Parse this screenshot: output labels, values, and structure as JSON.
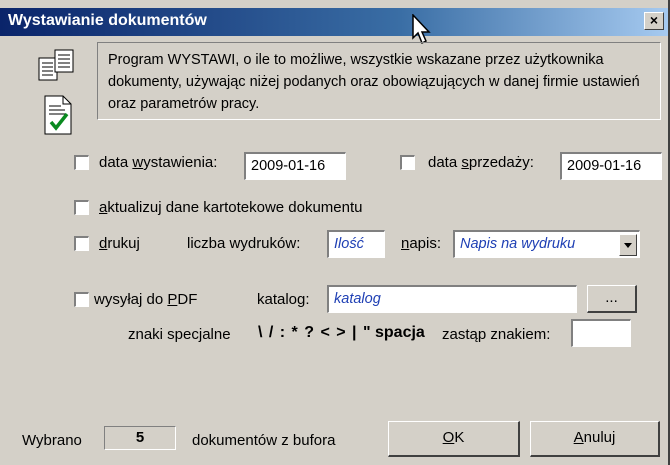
{
  "window": {
    "title": "Wystawianie dokumentów",
    "close_glyph": "×"
  },
  "info_text": "Program WYSTAWI, o ile to możliwe, wszystkie wskazane przez użytkownika dokumenty, używając niżej podanych oraz obowiązujących w danej firmie ustawień oraz parametrów pracy.",
  "icons": [
    "documents-icon",
    "document-check-icon"
  ],
  "issue_date": {
    "label_pre": "data ",
    "label_ul": "w",
    "label_post": "ystawienia:",
    "value": "2009-01-16",
    "checked": false
  },
  "sale_date": {
    "label_pre": "data ",
    "label_ul": "s",
    "label_post": "przedaży:",
    "value": "2009-01-16",
    "checked": false
  },
  "update_card": {
    "label_ul": "a",
    "label_post": "ktualizuj dane kartotekowe dokumentu",
    "checked": false
  },
  "print": {
    "label_ul": "d",
    "label_post": "rukuj",
    "checked": false,
    "copies_label": "liczba wydruków:",
    "copies_value": "Ilość",
    "caption_label_ul": "n",
    "caption_label_post": "apis:",
    "caption_value": "Napis na wydruku"
  },
  "pdf": {
    "label_pre": "wysyłaj do ",
    "label_ul": "P",
    "label_post": "DF",
    "checked": false,
    "folder_label": "katalog:",
    "folder_value": "katalog",
    "browse_label": "...",
    "special_label": "znaki specjalne",
    "special_chars": "\\ / : * ? < > | \"",
    "space_word": "spacja",
    "replace_label": "zastąp znakiem:",
    "replace_value": ""
  },
  "footer": {
    "selected_label": "Wybrano",
    "count": "5",
    "suffix": "dokumentów z bufora"
  },
  "buttons": {
    "ok_ul": "O",
    "ok_post": "K",
    "cancel_ul": "A",
    "cancel_post": "nuluj"
  }
}
